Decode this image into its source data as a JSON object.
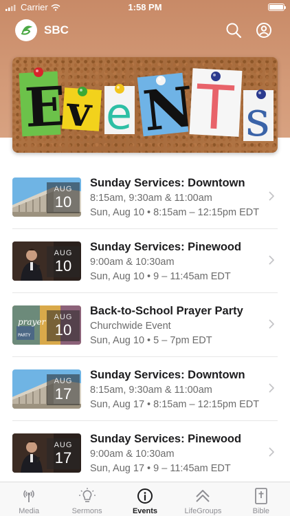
{
  "status_bar": {
    "carrier": "Carrier",
    "time": "1:58 PM"
  },
  "app": {
    "name": "SBC",
    "logo_icon": "sbc-logo-icon",
    "header_color": "#c88a67"
  },
  "hero": {
    "banner_text": "EVENTS",
    "alt": "Events banner"
  },
  "events": [
    {
      "title": "Sunday Services: Downtown",
      "subtitle": "8:15am, 9:30am & 11:00am",
      "when": "Sun, Aug 10 • 8:15am – 12:15pm EDT",
      "month": "AUG",
      "day": "10",
      "thumb": "building"
    },
    {
      "title": "Sunday Services: Pinewood",
      "subtitle": "9:00am & 10:30am",
      "when": "Sun, Aug 10 • 9 – 11:45am EDT",
      "month": "AUG",
      "day": "10",
      "thumb": "speaker"
    },
    {
      "title": "Back-to-School Prayer Party",
      "subtitle": "Churchwide Event",
      "when": "Sun, Aug 10 • 5 – 7pm EDT",
      "month": "AUG",
      "day": "10",
      "thumb": "prayer"
    },
    {
      "title": "Sunday Services: Downtown",
      "subtitle": "8:15am, 9:30am & 11:00am",
      "when": "Sun, Aug 17 • 8:15am – 12:15pm EDT",
      "month": "AUG",
      "day": "17",
      "thumb": "building"
    },
    {
      "title": "Sunday Services: Pinewood",
      "subtitle": "9:00am & 10:30am",
      "when": "Sun, Aug 17 • 9 – 11:45am EDT",
      "month": "AUG",
      "day": "17",
      "thumb": "speaker"
    }
  ],
  "tabs": [
    {
      "label": "Media",
      "icon": "broadcast-icon",
      "active": false
    },
    {
      "label": "Sermons",
      "icon": "lightbulb-icon",
      "active": false
    },
    {
      "label": "Events",
      "icon": "info-icon",
      "active": true
    },
    {
      "label": "LifeGroups",
      "icon": "chevrons-up-icon",
      "active": false
    },
    {
      "label": "Bible",
      "icon": "bible-icon",
      "active": false
    }
  ]
}
